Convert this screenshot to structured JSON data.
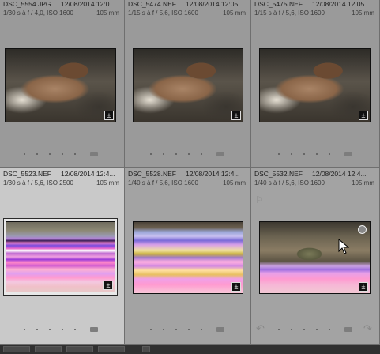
{
  "cells": [
    {
      "filename": "DSC_5554.JPG",
      "date": "12/08/2014 12:0...",
      "exposure": "1/30 s à f / 4,0, ISO 1600",
      "lens": "105 mm",
      "thumb": "frog"
    },
    {
      "filename": "DSC_5474.NEF",
      "date": "12/08/2014 12:05...",
      "exposure": "1/15 s à f / 5,6, ISO 1600",
      "lens": "105 mm",
      "thumb": "frog"
    },
    {
      "filename": "DSC_5475.NEF",
      "date": "12/08/2014 12:05...",
      "exposure": "1/15 s à f / 5,6, ISO 1600",
      "lens": "105 mm",
      "thumb": "frog"
    },
    {
      "filename": "DSC_5523.NEF",
      "date": "12/08/2014 12:4...",
      "exposure": "1/30 s à f / 5,6, ISO 2500",
      "lens": "105 mm",
      "thumb": "glitch1"
    },
    {
      "filename": "DSC_5528.NEF",
      "date": "12/08/2014 12:4...",
      "exposure": "1/40 s à f / 5,6, ISO 1600",
      "lens": "105 mm",
      "thumb": "glitch2"
    },
    {
      "filename": "DSC_5532.NEF",
      "date": "12/08/2014 12:4...",
      "exposure": "1/40 s à f / 5,6, ISO 1600",
      "lens": "105 mm",
      "thumb": "glitch3"
    }
  ],
  "icons": {
    "badge": "edit-adjust-icon",
    "flag": "flag-icon",
    "rotate_left": "rotate-left-icon",
    "rotate_right": "rotate-right-icon",
    "cursor": "mouse-cursor-icon"
  },
  "badge_glyph": "±",
  "flag_glyph": "⚐",
  "rotate_left_glyph": "↶",
  "rotate_right_glyph": "↷"
}
